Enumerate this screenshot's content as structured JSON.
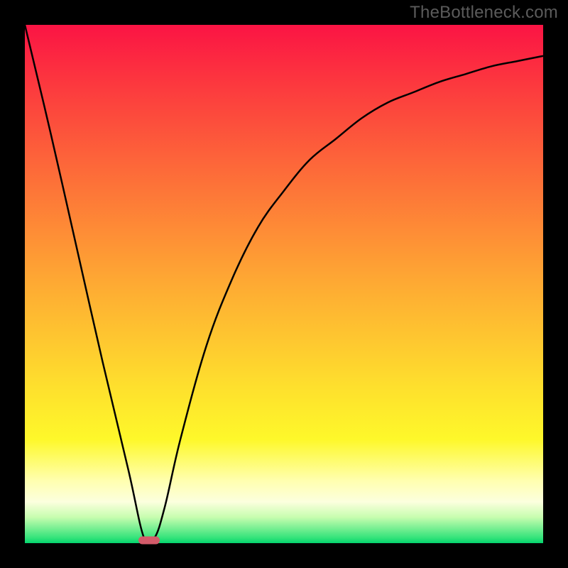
{
  "watermark": "TheBottleneck.com",
  "chart_data": {
    "type": "line",
    "title": "",
    "xlabel": "",
    "ylabel": "",
    "xlim": [
      0,
      100
    ],
    "ylim": [
      0,
      100
    ],
    "background_gradient": [
      "#fb1444",
      "#fd6a39",
      "#fee02d",
      "#ffffb0",
      "#03d46e"
    ],
    "series": [
      {
        "name": "curve",
        "x": [
          0,
          5,
          10,
          15,
          20,
          23,
          25,
          27,
          30,
          35,
          40,
          45,
          50,
          55,
          60,
          65,
          70,
          75,
          80,
          85,
          90,
          95,
          100
        ],
        "values": [
          100,
          79,
          57,
          35,
          14,
          1,
          1,
          7,
          20,
          38,
          51,
          61,
          68,
          74,
          78,
          82,
          85,
          87,
          89,
          90.5,
          92,
          93,
          94
        ]
      }
    ],
    "marker": {
      "x": 24,
      "y": 0.5,
      "color": "#d35b6a",
      "shape": "rounded-rect"
    }
  },
  "colors": {
    "frame": "#000000",
    "watermark": "#5b5b5b"
  }
}
